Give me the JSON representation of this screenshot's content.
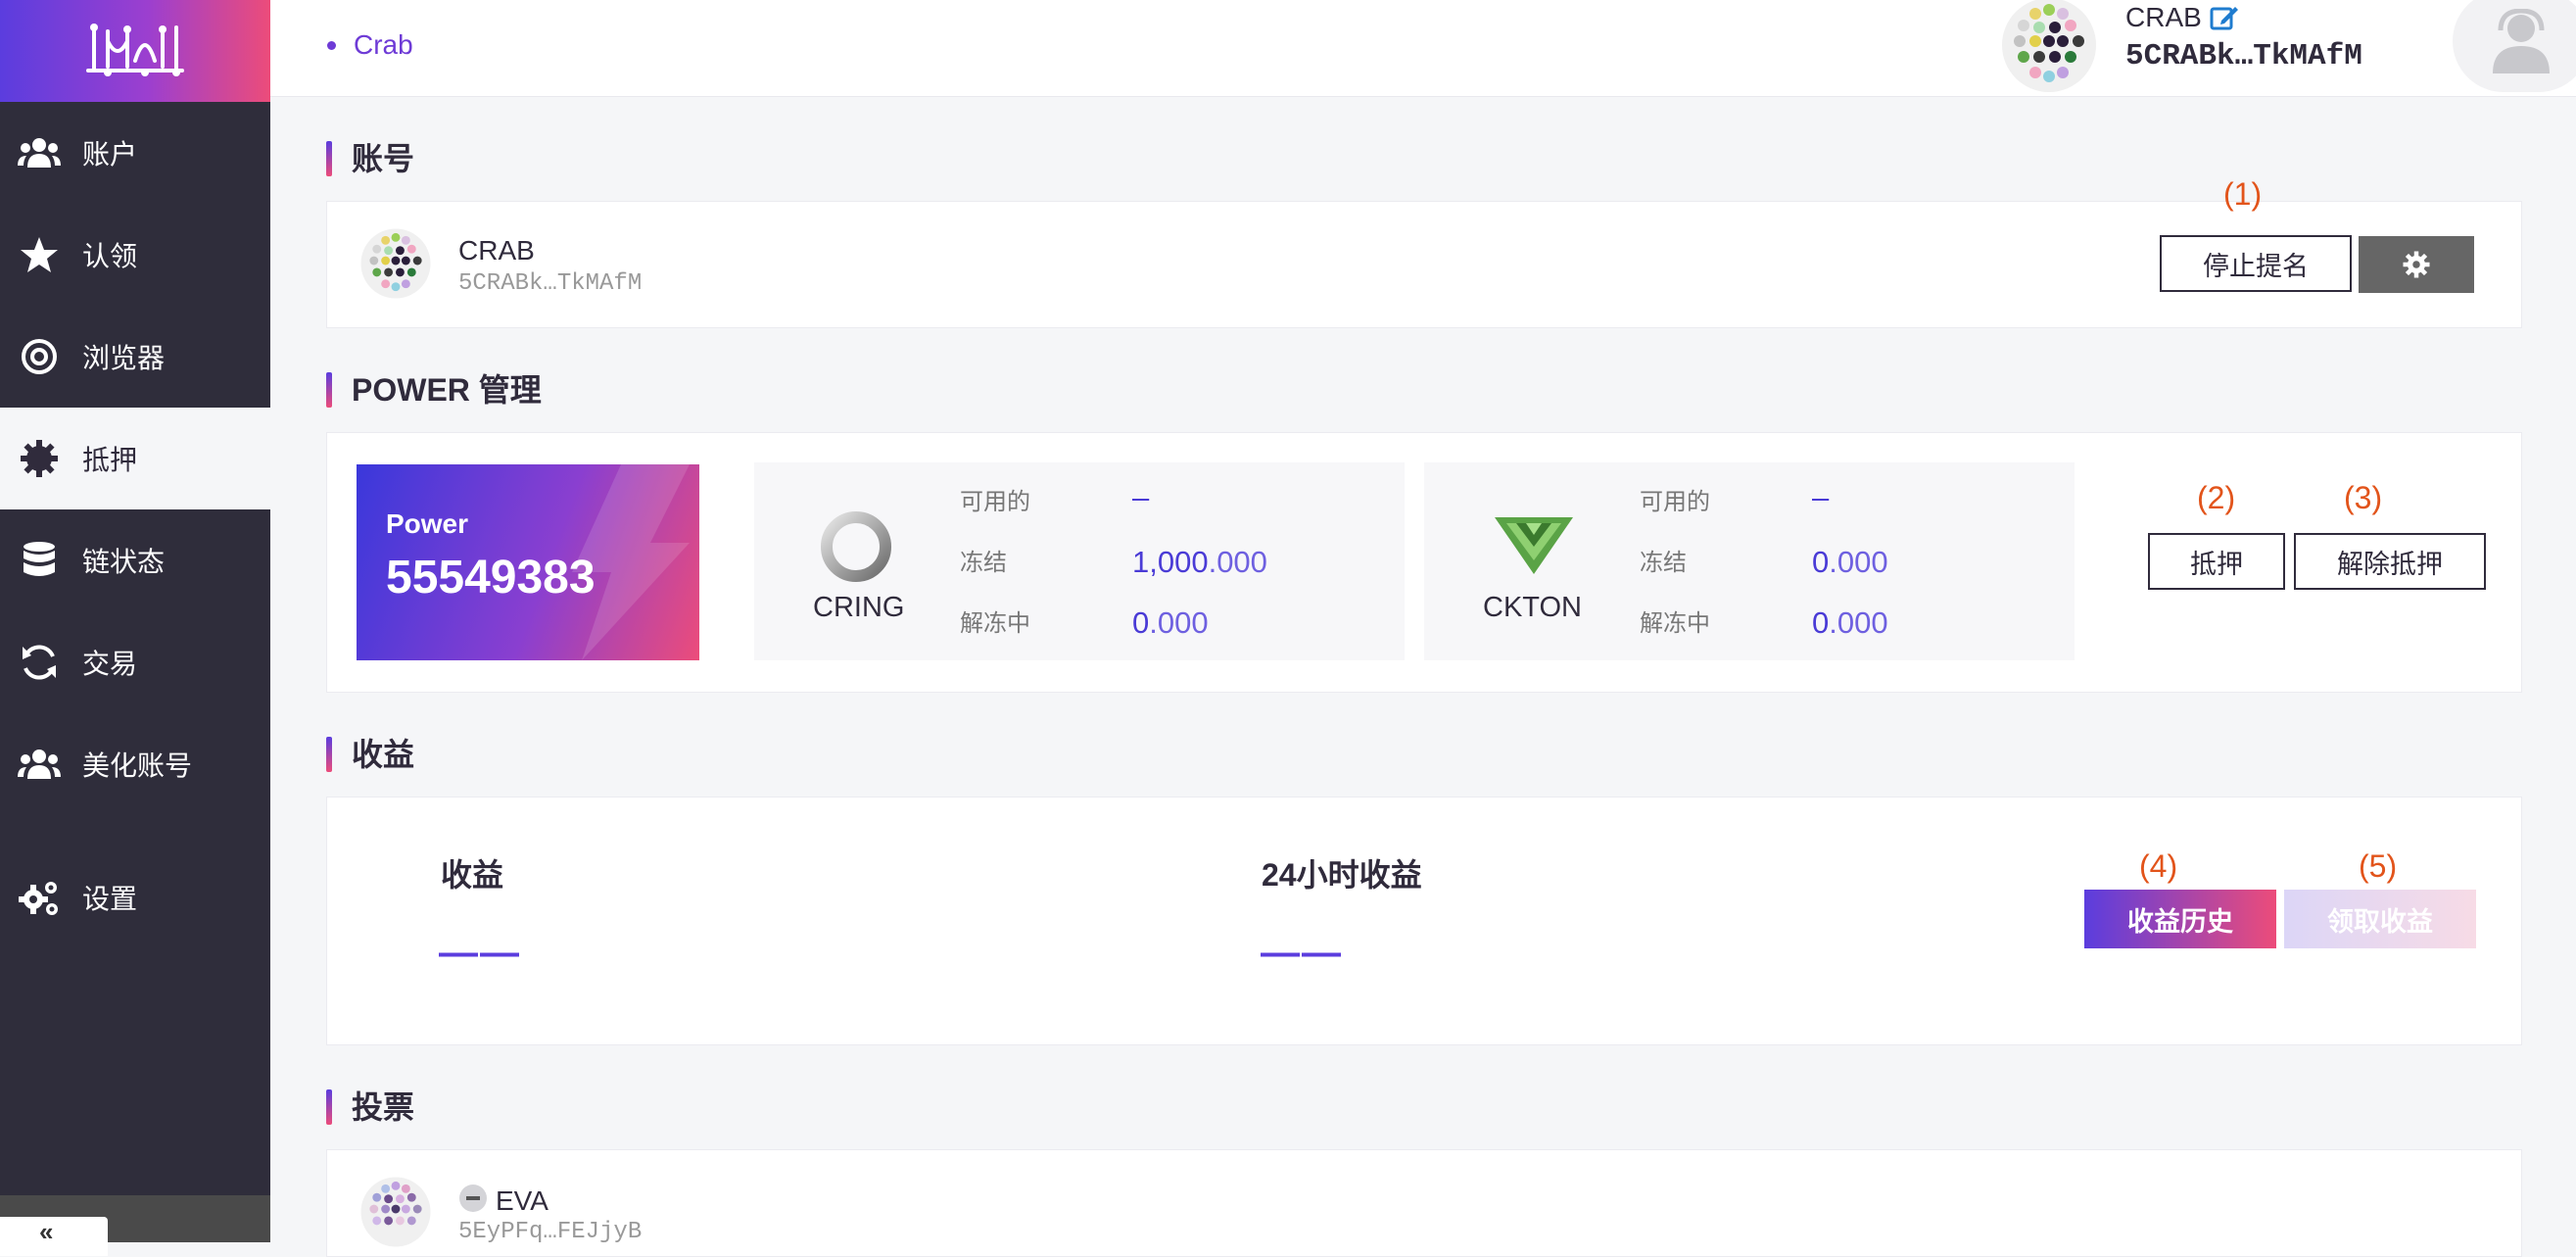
{
  "sidebar": {
    "items": [
      {
        "label": "账户",
        "icon": "users-icon"
      },
      {
        "label": "认领",
        "icon": "star-icon"
      },
      {
        "label": "浏览器",
        "icon": "target-icon"
      },
      {
        "label": "抵押",
        "icon": "gear-badge-icon",
        "active": true
      },
      {
        "label": "链状态",
        "icon": "database-icon"
      },
      {
        "label": "交易",
        "icon": "sync-icon"
      },
      {
        "label": "美化账号",
        "icon": "users-icon"
      },
      {
        "label": "设置",
        "icon": "cogs-icon"
      }
    ],
    "collapse_label": "«"
  },
  "header": {
    "breadcrumb": "Crab",
    "account_name": "CRAB",
    "account_address": "5CRABk…TkMAfM"
  },
  "account_section": {
    "title": "账号",
    "name": "CRAB",
    "address": "5CRABk…TkMAfM",
    "stop_nominate_label": "停止提名",
    "anno": "(1)"
  },
  "power_section": {
    "title": "POWER 管理",
    "power_label": "Power",
    "power_value": "55549383",
    "tokens": [
      {
        "name": "CRING",
        "available_label": "可用的",
        "available": "–",
        "frozen_label": "冻结",
        "frozen_int": "1,000",
        "frozen_frac": ".000",
        "unfreezing_label": "解冻中",
        "unfreezing_int": "0",
        "unfreezing_frac": ".000"
      },
      {
        "name": "CKTON",
        "available_label": "可用的",
        "available": "–",
        "frozen_label": "冻结",
        "frozen_int": "0",
        "frozen_frac": ".000",
        "unfreezing_label": "解冻中",
        "unfreezing_int": "0",
        "unfreezing_frac": ".000"
      }
    ],
    "stake_label": "抵押",
    "unstake_label": "解除抵押",
    "anno_stake": "(2)",
    "anno_unstake": "(3)"
  },
  "earnings_section": {
    "title": "收益",
    "earnings_label": "收益",
    "earnings_value": "——",
    "earnings_24h_label": "24小时收益",
    "earnings_24h_value": "——",
    "history_label": "收益历史",
    "claim_label": "领取收益",
    "anno_history": "(4)",
    "anno_claim": "(5)"
  },
  "voting_section": {
    "title": "投票",
    "name": "EVA",
    "address": "5EyPFq…FEJjyB"
  },
  "colors": {
    "accent": "#5b3dde",
    "accent_pink": "#ec4c7a",
    "sidebar_bg": "#2f2d3b",
    "annotation": "#e2541b"
  }
}
